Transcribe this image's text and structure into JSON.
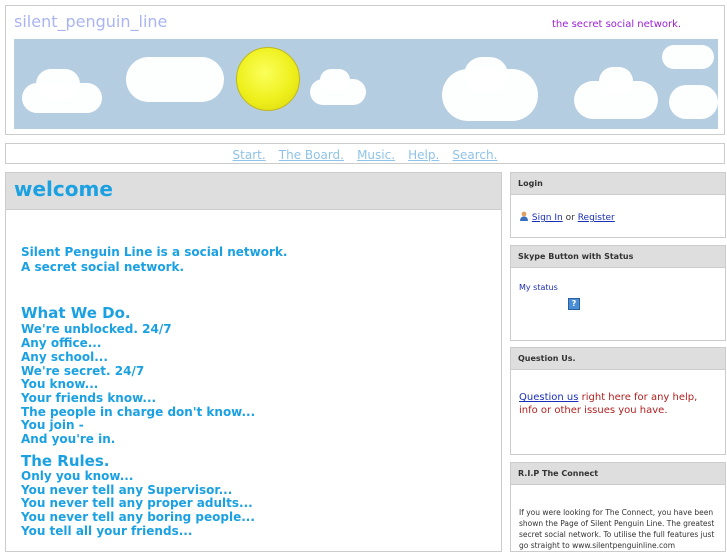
{
  "header": {
    "site_title": "silent_penguin_line",
    "tagline": "the secret social network."
  },
  "nav": {
    "items": [
      "Start.",
      "The Board.",
      "Music.",
      "Help.",
      "Search."
    ]
  },
  "main": {
    "title": "welcome",
    "intro": [
      "Silent Penguin Line is a social network.",
      "A secret social network."
    ],
    "section1_title": "What We Do.",
    "section1_lines": [
      "We're unblocked. 24/7",
      "Any office...",
      "Any school...",
      "We're secret. 24/7",
      "You know...",
      "Your friends know...",
      "The people in charge don't know...",
      "You join -",
      "And you're in."
    ],
    "section2_title": "The Rules.",
    "section2_lines": [
      "Only you know...",
      "You never tell any Supervisor...",
      "You never tell any proper adults...",
      "You never tell any boring people...",
      "You tell all your friends..."
    ]
  },
  "sidebar": {
    "login": {
      "title": "Login",
      "sign_in": "Sign In",
      "or": "or",
      "register": "Register"
    },
    "skype": {
      "title": "Skype Button with Status",
      "status_link": "My status",
      "status_icon": "?"
    },
    "question": {
      "title": "Question Us.",
      "link": "Question us",
      "text": " right here for any help, info or other issues you have."
    },
    "rip": {
      "title": "R.I.P The Connect",
      "text": "If you were looking for The Connect, you have been shown the Page of Silent Penguin Line. The greatest secret social network. To utilise the full features just go straight to www.silentpenguinline.com"
    }
  },
  "colors": {
    "accent": "#1ba1e2",
    "nav": "#8fc3e8",
    "tagline": "#9b1fd6",
    "link": "#1a2fb5",
    "question_text": "#b02020"
  }
}
